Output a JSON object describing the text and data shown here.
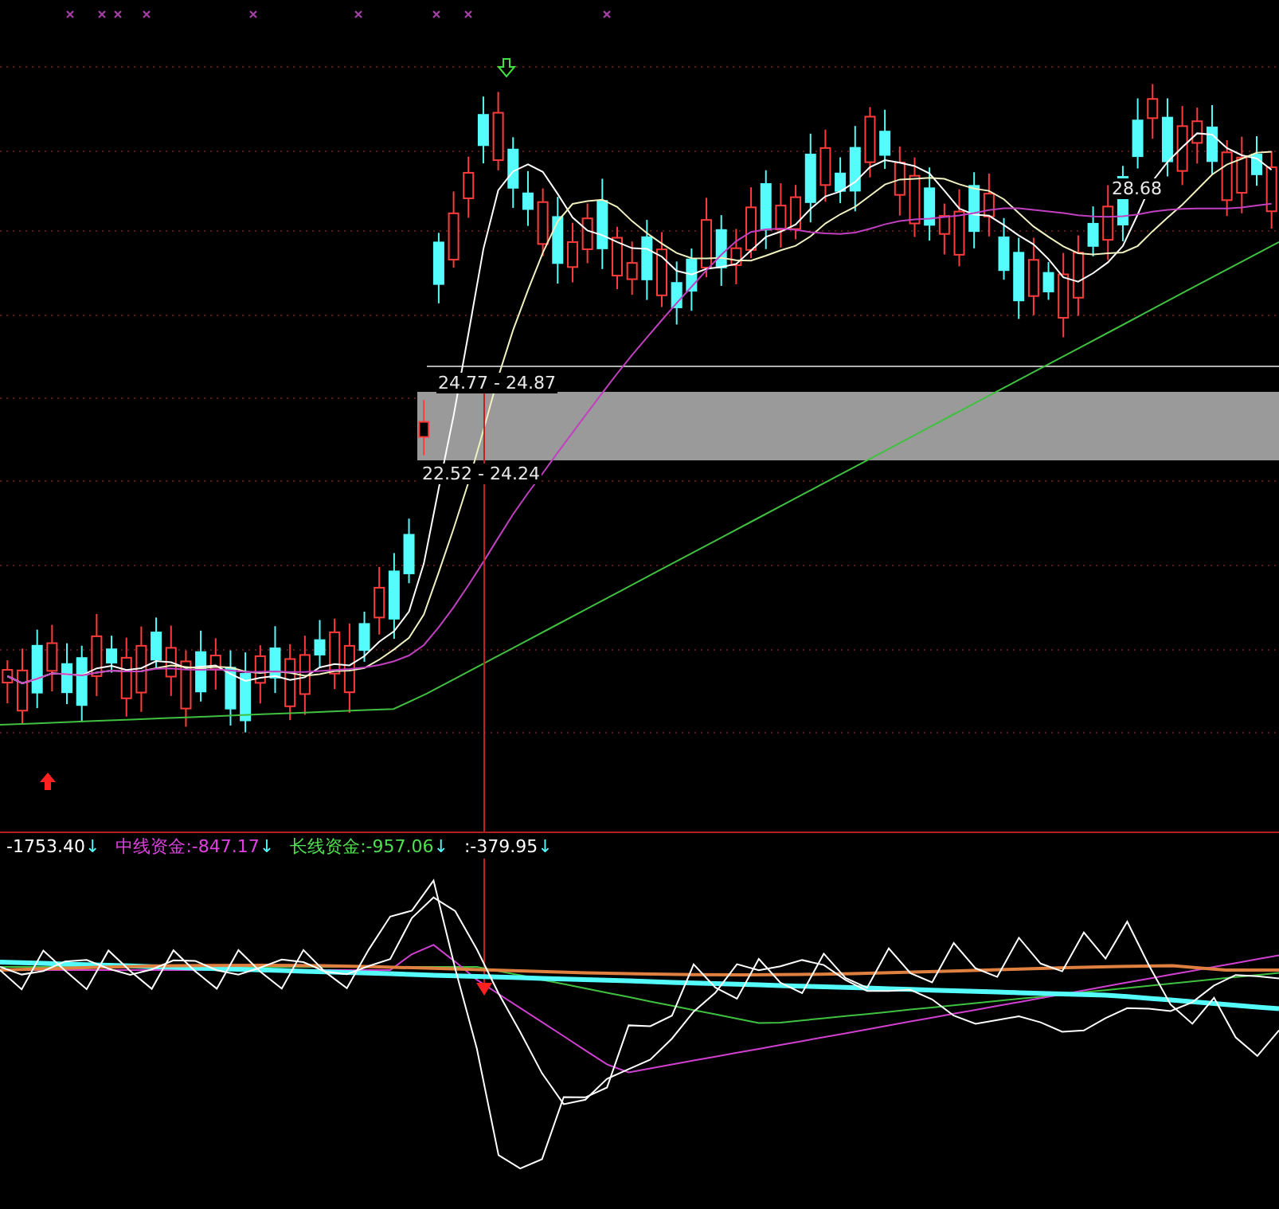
{
  "price_labels": [
    {
      "text": "24.77 - 24.87"
    },
    {
      "text": "22.52 - 24.24"
    },
    {
      "text": "28.68"
    }
  ],
  "indicator_legend": [
    {
      "value": "-1753.40",
      "arrow": "↓",
      "color": "#ffffff"
    },
    {
      "label": "中线资金",
      "value": ":-847.17",
      "arrow": "↓",
      "color": "#e040e0"
    },
    {
      "label": "长线资金",
      "value": ":-957.06",
      "arrow": "↓",
      "color": "#50e050"
    },
    {
      "value": ":-379.95",
      "arrow": "↓",
      "color": "#ffffff"
    }
  ]
}
